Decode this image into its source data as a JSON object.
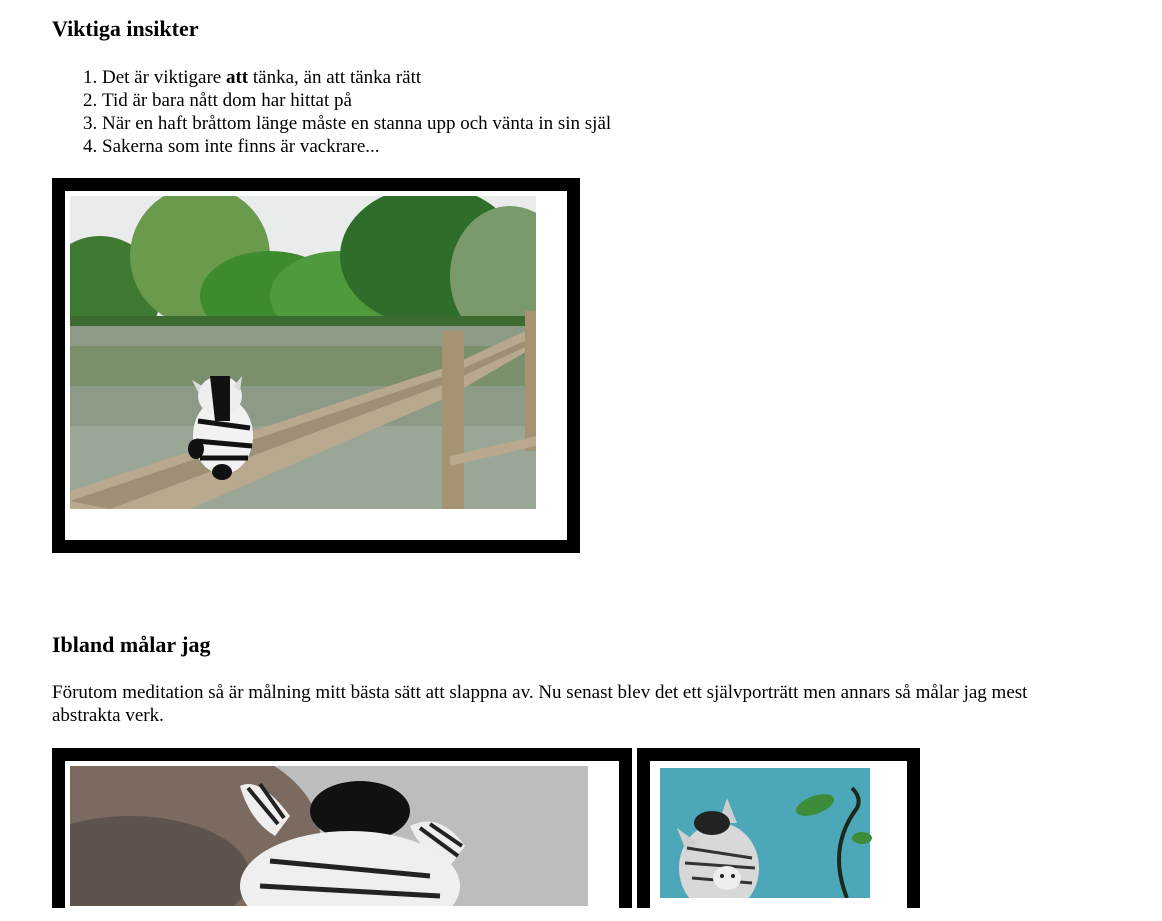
{
  "insights": {
    "heading": "Viktiga insikter",
    "items": [
      {
        "before": "Det är viktigare ",
        "bold": "att",
        "after": " tänka, än att tänka rätt"
      },
      {
        "text": "Tid är bara nått dom har hittat på"
      },
      {
        "text": "När en haft bråttom länge måste en stanna upp och vänta in sin själ"
      },
      {
        "text": "Sakerna som inte finns är vackrare..."
      }
    ]
  },
  "painting": {
    "heading": "Ibland målar jag",
    "intro": "Förutom meditation så är målning mitt bästa sätt att slappna av. Nu senast blev det ett självporträtt men annars så målar jag mest abstrakta verk."
  },
  "images": [
    {
      "name": "zebra-plush-on-bridge-photo"
    },
    {
      "name": "zebra-plush-closeup-photo"
    },
    {
      "name": "zebra-self-portrait-painting"
    }
  ]
}
